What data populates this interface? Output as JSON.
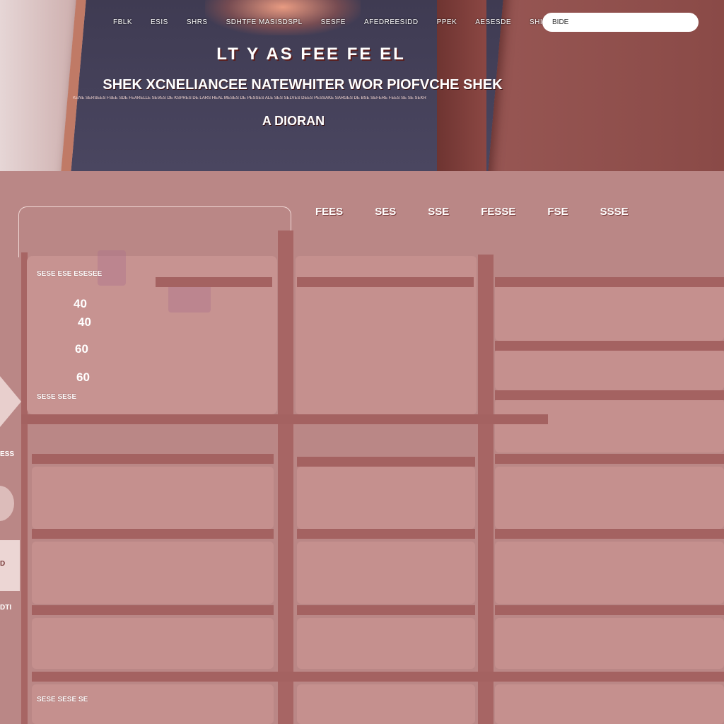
{
  "header": {
    "nav_items": [
      "FBLK",
      "ESIS",
      "SHRS",
      "SDHTFE MASISDSPL",
      "SESFE",
      "AFEDREESIDD",
      "PPEK",
      "AESESDE",
      "SHIS"
    ],
    "search_placeholder": "BIDE"
  },
  "hero": {
    "title": "LT Y AS FEE FE EL",
    "subtitle": "SHEK XCNELIANCEE NATEWHITER  WOR PIOFVCHE  SHEK",
    "fine_print": "KENE SERSEES FSEE SDE FEARELLE SEVES DE KSPRES DE LARS HEAL MESES DE PESSES ALE SES SELVES DEES PESSAKE SARGES DE BSE SEFERE FEES SE SE SEKR",
    "byline": "A DIORAN"
  },
  "tabs": [
    "FEES",
    "SES",
    "SSE",
    "FESSE",
    "FSE",
    "SSSE"
  ],
  "panel": {
    "top_label": "SESE ESE  ESESEE",
    "numbers": [
      "40",
      "40",
      "60",
      "60"
    ],
    "bottom_label": "SESE SESE",
    "footer_label": "SESE SESE SE"
  },
  "side": {
    "label_top": "ESS",
    "label_mid": "D",
    "label_bottom": "DTI"
  },
  "colors": {
    "page_bg": "#ba8786",
    "bar": "#a76564",
    "cell": "#c5908e",
    "search_bg": "#ffffff"
  }
}
